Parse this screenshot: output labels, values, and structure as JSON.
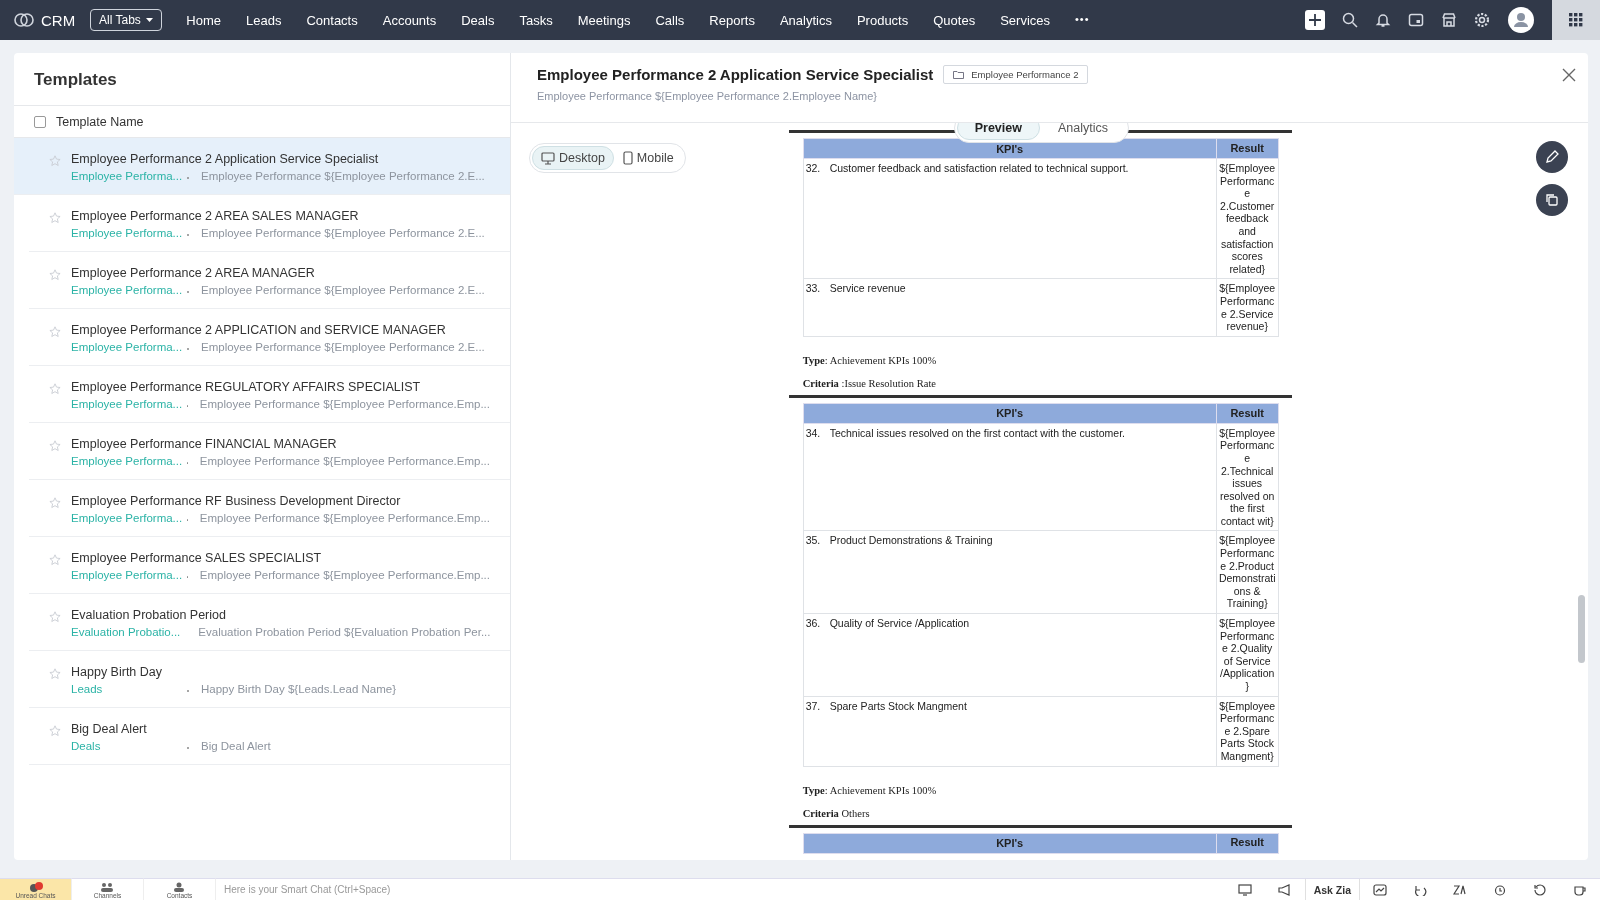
{
  "topbar": {
    "brand": "CRM",
    "all_tabs": "All Tabs",
    "nav": [
      {
        "label": "Home",
        "selected": false
      },
      {
        "label": "Leads",
        "selected": false
      },
      {
        "label": "Contacts",
        "selected": false
      },
      {
        "label": "Accounts",
        "selected": false
      },
      {
        "label": "Deals",
        "selected": false
      },
      {
        "label": "Tasks",
        "selected": false
      },
      {
        "label": "Meetings",
        "selected": false
      },
      {
        "label": "Calls",
        "selected": false
      },
      {
        "label": "Reports",
        "selected": false
      },
      {
        "label": "Analytics",
        "selected": false
      },
      {
        "label": "Products",
        "selected": false
      },
      {
        "label": "Quotes",
        "selected": false
      },
      {
        "label": "Services",
        "selected": false
      }
    ],
    "more": "•••"
  },
  "templates": {
    "title": "Templates",
    "column": "Template Name",
    "select_all_checked": false,
    "items": [
      {
        "name": "Employee Performance 2 Application Service Specialist",
        "module": "Employee Performa...",
        "subject": "Employee Performance ${Employee Performance 2.E...",
        "selected": true,
        "starred": false
      },
      {
        "name": "Employee Performance 2 AREA SALES MANAGER",
        "module": "Employee Performa...",
        "subject": "Employee Performance ${Employee Performance 2.E...",
        "selected": false,
        "starred": false
      },
      {
        "name": "Employee Performance 2 AREA MANAGER",
        "module": "Employee Performa...",
        "subject": "Employee Performance ${Employee Performance 2.E...",
        "selected": false,
        "starred": false
      },
      {
        "name": "Employee Performance 2 APPLICATION and SERVICE MANAGER",
        "module": "Employee Performa...",
        "subject": "Employee Performance ${Employee Performance 2.E...",
        "selected": false,
        "starred": false
      },
      {
        "name": "Employee Performance REGULATORY AFFAIRS SPECIALIST",
        "module": "Employee Performa...",
        "subject": "Employee Performance ${Employee Performance.Emp...",
        "selected": false,
        "starred": false
      },
      {
        "name": "Employee Performance FINANCIAL MANAGER",
        "module": "Employee Performa...",
        "subject": "Employee Performance ${Employee Performance.Emp...",
        "selected": false,
        "starred": false
      },
      {
        "name": "Employee Performance RF Business Development Director",
        "module": "Employee Performa...",
        "subject": "Employee Performance ${Employee Performance.Emp...",
        "selected": false,
        "starred": false
      },
      {
        "name": "Employee Performance SALES SPECIALIST",
        "module": "Employee Performa...",
        "subject": "Employee Performance ${Employee Performance.Emp...",
        "selected": false,
        "starred": false
      },
      {
        "name": "Evaluation Probation Period",
        "module": "Evaluation Probatio...",
        "subject": "Evaluation Probation Period ${Evaluation Probation Per...",
        "selected": false,
        "starred": false
      },
      {
        "name": "Happy Birth Day",
        "module": "Leads",
        "subject": "Happy Birth Day ${Leads.Lead Name}",
        "selected": false,
        "starred": false
      },
      {
        "name": "Big Deal Alert",
        "module": "Deals",
        "subject": "Big Deal Alert",
        "selected": false,
        "starred": false
      }
    ]
  },
  "preview": {
    "title": "Employee Performance 2 Application Service Specialist",
    "folder": "Employee Performance 2",
    "subject": "Employee Performance ${Employee Performance 2.Employee Name}",
    "view_tabs": [
      {
        "label": "Preview",
        "selected": true
      },
      {
        "label": "Analytics",
        "selected": false
      }
    ],
    "devices": [
      {
        "label": "Desktop",
        "kind": "desktop",
        "selected": true
      },
      {
        "label": "Mobile",
        "kind": "mobile",
        "selected": false
      }
    ],
    "document": [
      {
        "kind": "table",
        "columns": [
          "KPI's",
          "Result"
        ],
        "rows": [
          {
            "number": "32.",
            "kpi": "Customer feedback and satisfaction  related to technical support.",
            "result": "${Employee Performanc e 2.Customer feedback and satisfaction scores related}"
          },
          {
            "number": "33.",
            "kpi": "Service revenue",
            "result": "${Employee Performanc e 2.Service revenue}"
          }
        ]
      },
      {
        "kind": "meta",
        "text": "**Type**: Achievement KPIs 100%"
      },
      {
        "kind": "meta",
        "text": "**Criteria** :Issue Resolution Rate"
      },
      {
        "kind": "table",
        "columns": [
          "KPI's",
          "Result"
        ],
        "rows": [
          {
            "number": "34.",
            "kpi": "Technical issues resolved on the first contact with the customer.",
            "result": "${Employee Performanc e 2.Technical issues resolved on the first contact wit}"
          },
          {
            "number": "35.",
            "kpi": "Product Demonstrations & Training",
            "result": "${Employee Performanc e 2.Product Demonstrati ons & Training}"
          },
          {
            "number": "36.",
            "kpi": "Quality of Service /Application",
            "result": "${Employee Performanc e 2.Quality of Service /Application}"
          },
          {
            "number": "37.",
            "kpi": "Spare Parts Stock Mangment",
            "result": "${Employee Performanc e 2.Spare Parts Stock Mangment}"
          }
        ]
      },
      {
        "kind": "meta",
        "text": "**Type**: Achievement KPIs 100%"
      },
      {
        "kind": "meta",
        "text": "**Criteria** Others"
      },
      {
        "kind": "table",
        "columns": [
          "KPI's",
          "Result"
        ]
      }
    ]
  },
  "bottombar": {
    "tabs": [
      {
        "label": "Unread Chats",
        "kind": "chats",
        "selected": true
      },
      {
        "label": "Channels",
        "kind": "channels",
        "selected": false
      },
      {
        "label": "Contacts",
        "kind": "contacts",
        "selected": false
      }
    ],
    "chat_placeholder": "Here is your Smart Chat (Ctrl+Space)",
    "ask_zia": "Ask Zia"
  }
}
